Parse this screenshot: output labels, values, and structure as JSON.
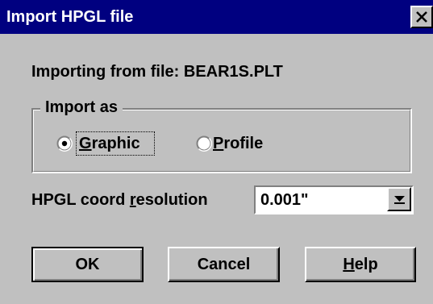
{
  "window": {
    "title": "Import HPGL file",
    "close_icon": "close-icon"
  },
  "info": {
    "importing_label": "Importing from file: BEAR1S.PLT"
  },
  "import_as": {
    "legend": "Import as",
    "options": [
      {
        "access_key": "G",
        "rest": "raphic",
        "selected": true
      },
      {
        "access_key": "P",
        "rest": "rofile",
        "selected": false
      }
    ]
  },
  "resolution": {
    "label_prefix": "HPGL coord ",
    "label_key": "r",
    "label_suffix": "esolution",
    "selected_value": "0.001\""
  },
  "buttons": {
    "ok": "OK",
    "cancel": "Cancel",
    "help_key": "H",
    "help_rest": "elp"
  },
  "colors": {
    "title_bar": "#000080",
    "face": "#c0c0c0",
    "shadow": "#808080",
    "highlight": "#ffffff",
    "field": "#ffffff"
  }
}
